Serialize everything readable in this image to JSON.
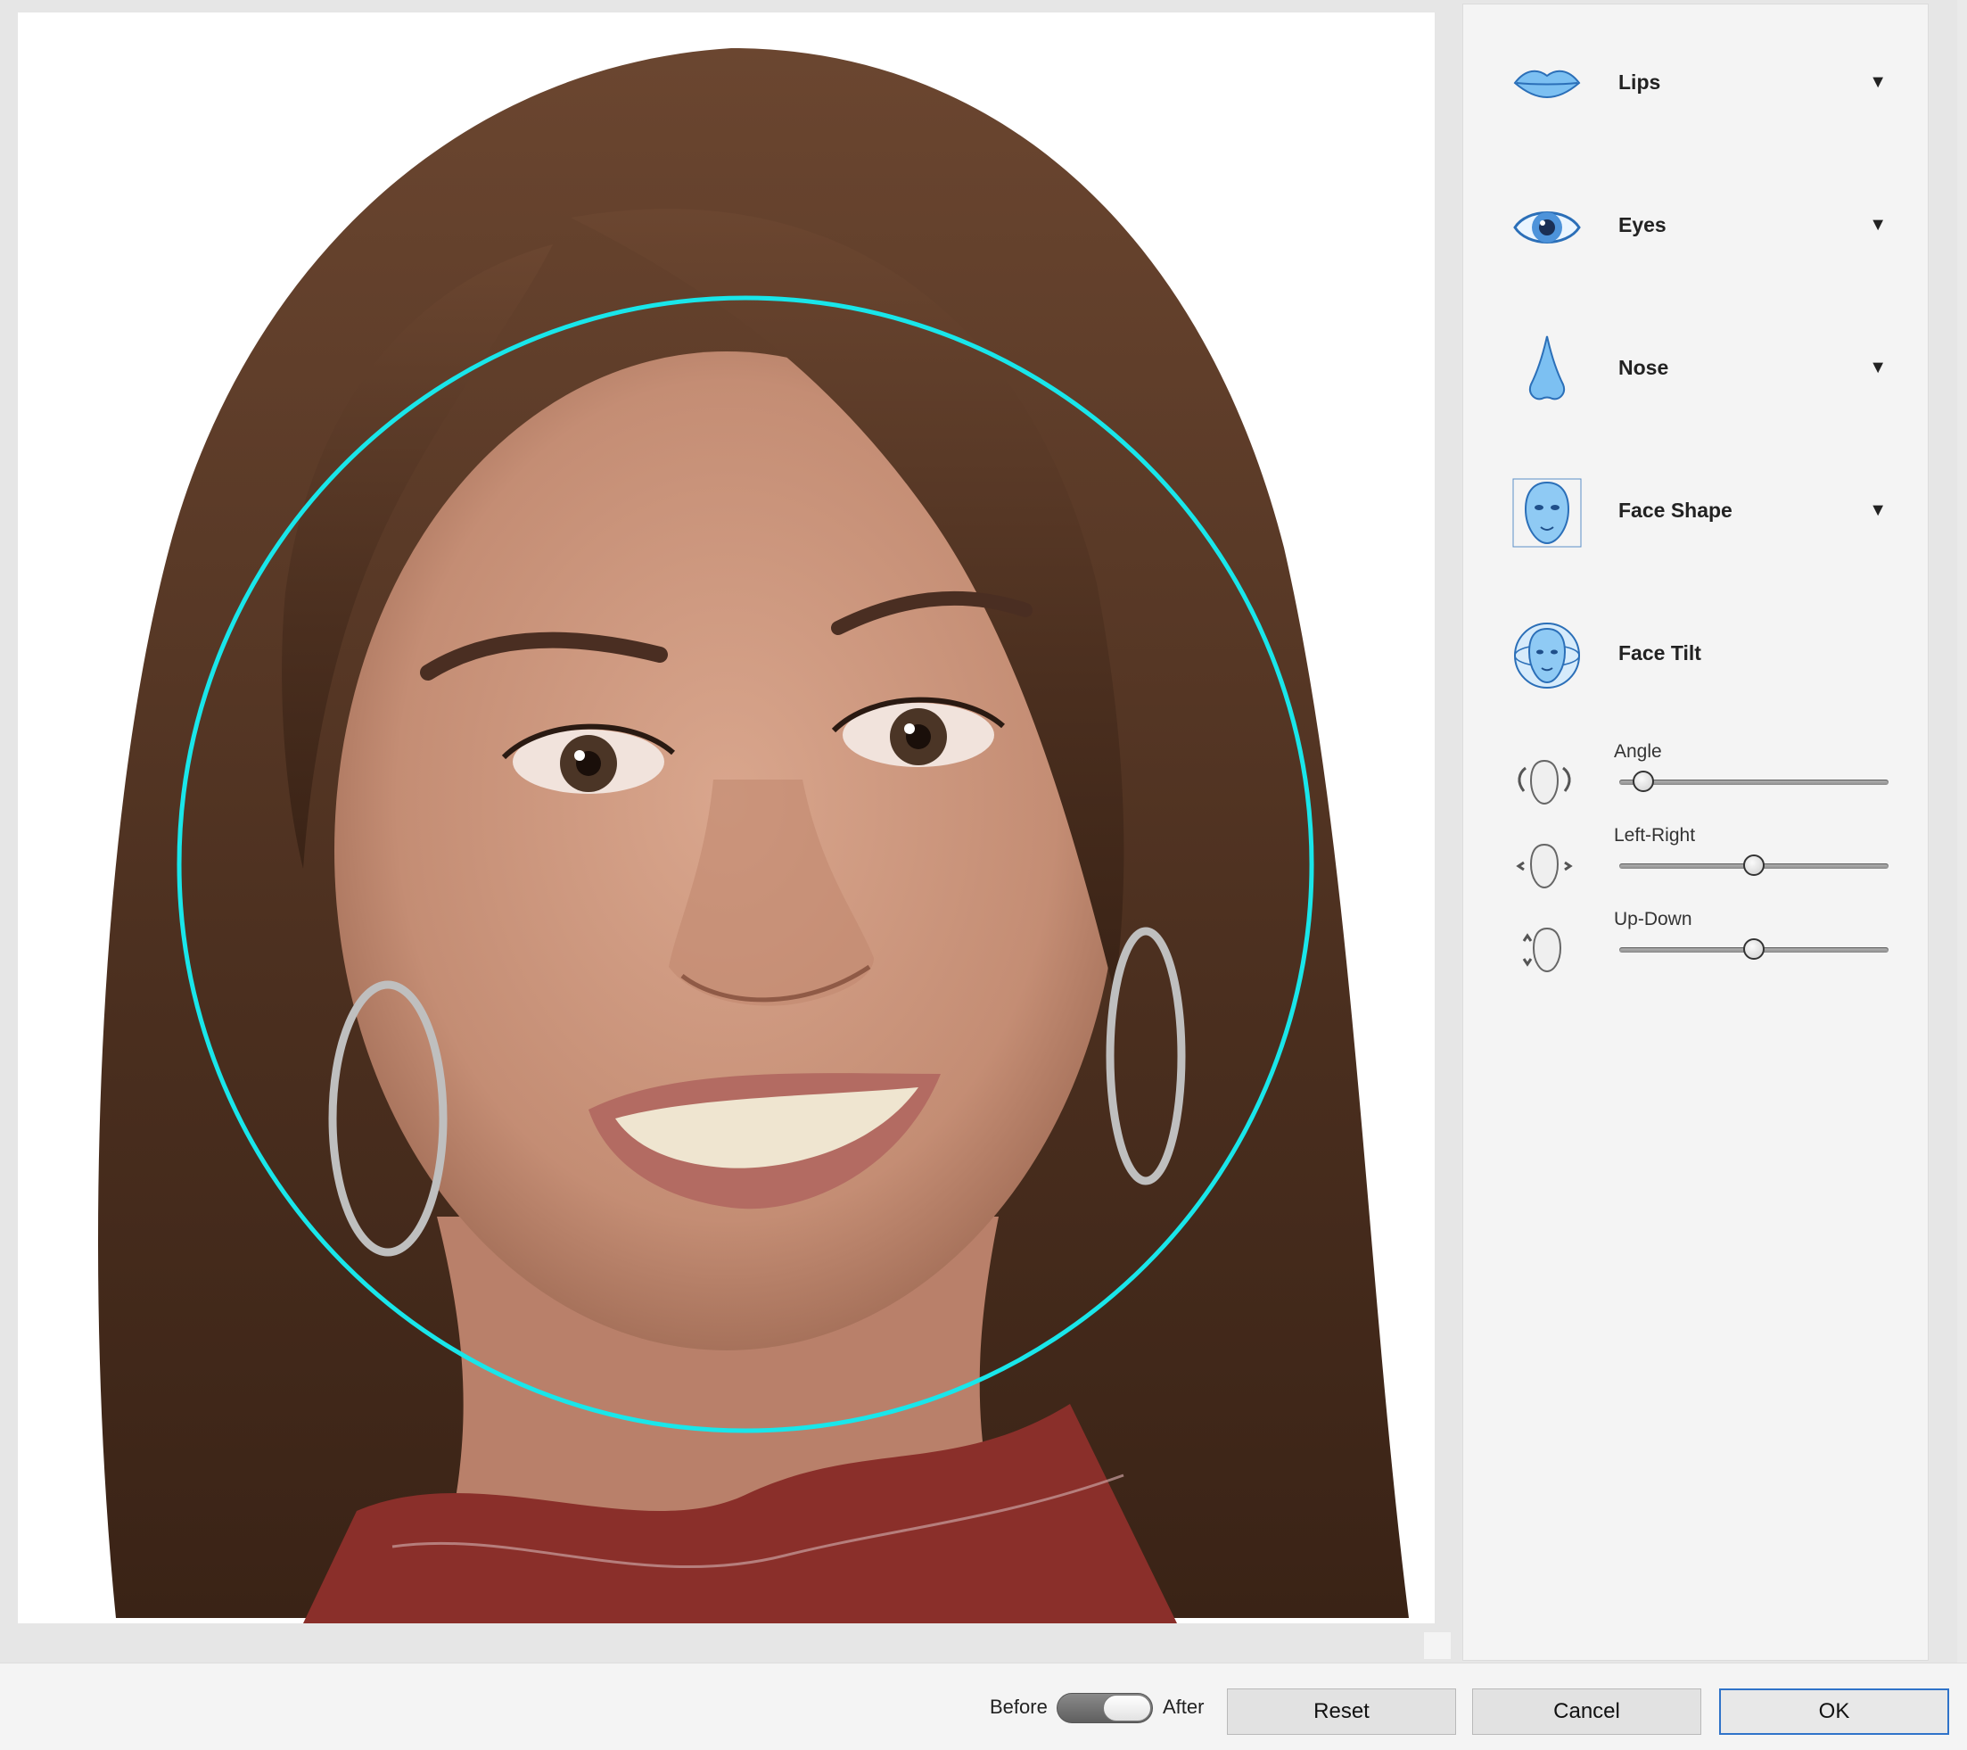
{
  "canvas": {
    "image": "portrait-photo",
    "overlay": "face-circle",
    "overlay_color": "#19e6ea"
  },
  "panel": {
    "sections": [
      {
        "label": "Lips",
        "icon": "lips-icon",
        "expandable": true
      },
      {
        "label": "Eyes",
        "icon": "eye-icon",
        "expandable": true
      },
      {
        "label": "Nose",
        "icon": "nose-icon",
        "expandable": true
      },
      {
        "label": "Face Shape",
        "icon": "face-shape-icon",
        "expandable": true
      },
      {
        "label": "Face Tilt",
        "icon": "face-tilt-icon",
        "expandable": false
      }
    ],
    "caret_glyph": "▼",
    "sliders": [
      {
        "label": "Angle",
        "icon": "angle-rotate-icon",
        "value": 0.09
      },
      {
        "label": "Left-Right",
        "icon": "left-right-icon",
        "value": 0.5
      },
      {
        "label": "Up-Down",
        "icon": "up-down-icon",
        "value": 0.5
      }
    ]
  },
  "footer": {
    "before_label": "Before",
    "after_label": "After",
    "toggle_state": "after",
    "reset_label": "Reset",
    "cancel_label": "Cancel",
    "ok_label": "OK"
  },
  "colors": {
    "accent": "#2f73c9",
    "icon_blue": "#6fb0ec",
    "panel_bg": "#f4f4f4"
  }
}
